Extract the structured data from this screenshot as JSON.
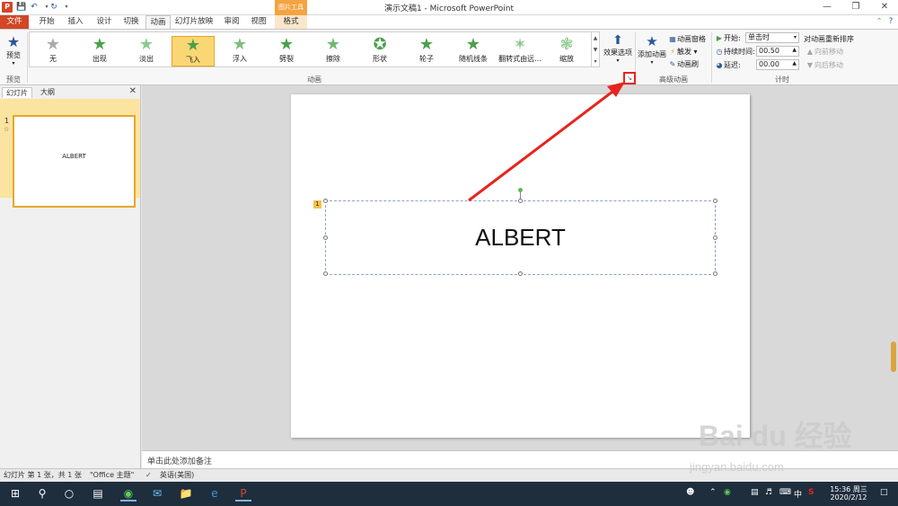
{
  "window": {
    "title": "演示文稿1 - Microsoft PowerPoint",
    "app_icon": "P",
    "context_tab_group": "图片工具",
    "controls": [
      "minimize-icon",
      "maximize-icon",
      "close-icon"
    ]
  },
  "quick_access": [
    "save-icon",
    "undo-icon",
    "redo-icon"
  ],
  "tabs": [
    {
      "label": "文件"
    },
    {
      "label": "开始"
    },
    {
      "label": "插入"
    },
    {
      "label": "设计"
    },
    {
      "label": "切换"
    },
    {
      "label": "动画"
    },
    {
      "label": "幻灯片放映"
    },
    {
      "label": "审阅"
    },
    {
      "label": "视图"
    },
    {
      "label": "格式"
    }
  ],
  "ribbon": {
    "preview": {
      "label": "预览",
      "group": "预览"
    },
    "animations": {
      "group": "动画",
      "items": [
        {
          "label": "无"
        },
        {
          "label": "出现"
        },
        {
          "label": "淡出"
        },
        {
          "label": "飞入"
        },
        {
          "label": "浮入"
        },
        {
          "label": "劈裂"
        },
        {
          "label": "擦除"
        },
        {
          "label": "形状"
        },
        {
          "label": "轮子"
        },
        {
          "label": "随机线条"
        },
        {
          "label": "翻转式由远..."
        },
        {
          "label": "缩放"
        }
      ],
      "selected": "飞入"
    },
    "effect_options": {
      "label": "效果选项"
    },
    "advanced": {
      "group": "高级动画",
      "add_animation": "添加动画",
      "pane": "动画窗格",
      "trigger": "触发",
      "painter": "动画刷"
    },
    "timing": {
      "group": "计时",
      "start_label": "开始:",
      "start_value": "单击时",
      "duration_label": "持续时间:",
      "duration_value": "00.50",
      "delay_label": "延迟:",
      "delay_value": "00.00",
      "reorder_title": "对动画重新排序",
      "move_earlier": "向前移动",
      "move_later": "向后移动"
    }
  },
  "left_panel": {
    "tabs": [
      "幻灯片",
      "大纲"
    ],
    "slide_number": "1",
    "thumb_text": "ALBERT"
  },
  "slide": {
    "text": "ALBERT",
    "anim_tag": "1"
  },
  "notes": {
    "placeholder": "单击此处添加备注"
  },
  "status": {
    "slide_info": "幻灯片 第 1 张，共 1 张",
    "theme": "\"Office 主题\"",
    "language": "英语(美国)"
  },
  "taskbar": {
    "time": "15:36 周三",
    "date": "2020/2/12",
    "ime": "中",
    "antivirus": "S"
  },
  "watermark": {
    "brand": "Bai du 经验",
    "url": "jingyan.baidu.com"
  }
}
